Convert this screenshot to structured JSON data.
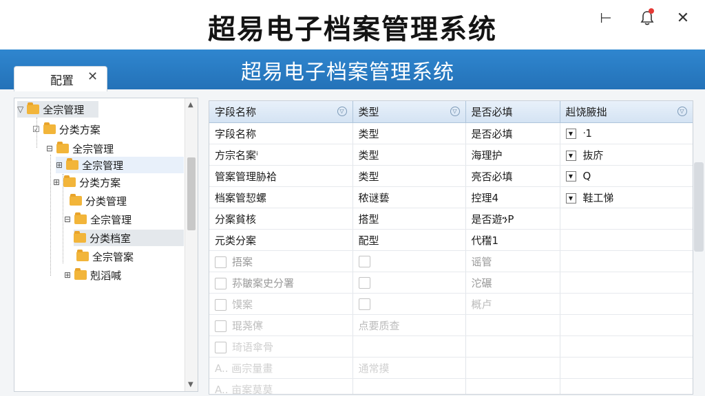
{
  "window": {
    "title": "超易电子档案管理系统",
    "subtitle": "超易电子档案管理系统",
    "buttons": {
      "minimize": "⊢",
      "close": "✕"
    }
  },
  "tab": {
    "label": "配置",
    "close": "✕"
  },
  "tree": [
    {
      "label": "全宗管理",
      "toggle": "▽",
      "depth": 0
    },
    {
      "label": "分类方案",
      "toggle": "☑",
      "depth": 1
    },
    {
      "label": "全宗管理",
      "toggle": "⊟",
      "depth": 2
    },
    {
      "label": "全宗管理",
      "toggle": "⊞",
      "depth": 3
    },
    {
      "label": "分类方案",
      "toggle": "⊞",
      "depth": 2
    },
    {
      "label": "分类管理",
      "toggle": "",
      "depth": 3
    },
    {
      "label": "全宗管理",
      "toggle": "⊟",
      "depth": 2
    },
    {
      "label": "分类档室",
      "toggle": "",
      "depth": 3
    },
    {
      "label": "全宗管案",
      "toggle": "",
      "depth": 3
    },
    {
      "label": "剋滔喊",
      "toggle": "⊞",
      "depth": 1
    }
  ],
  "grid": {
    "headers": [
      "字段名称",
      "类型",
      "是否必填",
      "赳饶腋拙"
    ],
    "rows": [
      {
        "c1": "字段名称",
        "c2": "类型",
        "c3": "是否必填",
        "c4": "ᐧ1",
        "dd": true
      },
      {
        "c1": "方宗名案ⁱ",
        "c2": "类型",
        "c3": "海理护",
        "c4": "抜庎",
        "dd": true
      },
      {
        "c1": "管案管理胁袷",
        "c2": "类型",
        "c3": "亮否必填",
        "c4": "Q",
        "dd": true
      },
      {
        "c1": "档案管恝螺",
        "c2": "秾谜兿",
        "c3": "控理4",
        "c4": "鞋工悌",
        "dd": true
      },
      {
        "c1": "分案貧核",
        "c2": "搭型",
        "c3": "是否遊ንP",
        "c4": "",
        "dd": false
      },
      {
        "c1": "元类分案",
        "c2": "配型",
        "c3": "代䆌1",
        "c4": "",
        "dd": false
      },
      {
        "c1": "捂案",
        "c2": "",
        "c3": "谣管",
        "c4": "",
        "cb": true,
        "fade": 1
      },
      {
        "c1": "荪皺案史分署",
        "c2": "",
        "c3": "沱碾",
        "c4": "",
        "cb": true,
        "fade": 1
      },
      {
        "c1": "馍案",
        "c2": "",
        "c3": "概卢",
        "c4": "",
        "cb": true,
        "fade": 2
      },
      {
        "c1": "琨荛㒏",
        "c2": "点要质查",
        "c3": "",
        "c4": "",
        "cb": true,
        "fade": 2
      },
      {
        "c1": "琦语傘骨",
        "c2": "",
        "c3": "",
        "c4": "",
        "cb": true,
        "fade": 3
      },
      {
        "c1": "A.. 画宗量畫",
        "c2": "通常摸",
        "c3": "",
        "c4": "",
        "fade": 3
      },
      {
        "c1": "A.. 亩案莫莫",
        "c2": "",
        "c3": "",
        "c4": "",
        "fade": 3
      }
    ]
  },
  "colors": {
    "band": "#2a7cc4",
    "header": "#dbe7f4",
    "folder": "#f2b53a"
  },
  "icons": [
    "minimize-icon",
    "bell-icon",
    "close-icon",
    "folder-icon",
    "checkbox-icon",
    "dropdown-icon"
  ]
}
